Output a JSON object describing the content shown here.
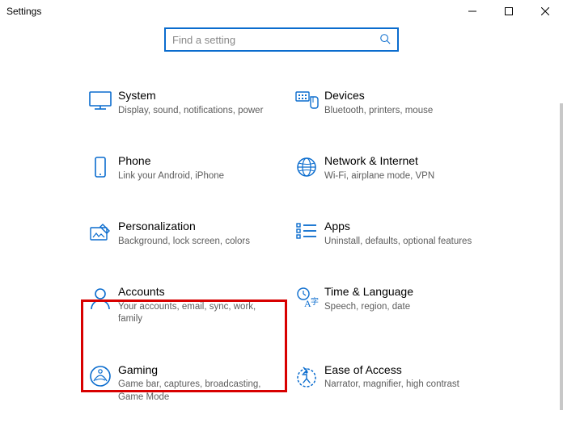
{
  "window": {
    "title": "Settings",
    "minimize": "–",
    "maximize": "☐",
    "close": "✕"
  },
  "search": {
    "placeholder": "Find a setting"
  },
  "tiles": {
    "system": {
      "title": "System",
      "sub": "Display, sound, notifications, power"
    },
    "devices": {
      "title": "Devices",
      "sub": "Bluetooth, printers, mouse"
    },
    "phone": {
      "title": "Phone",
      "sub": "Link your Android, iPhone"
    },
    "network": {
      "title": "Network & Internet",
      "sub": "Wi-Fi, airplane mode, VPN"
    },
    "personalization": {
      "title": "Personalization",
      "sub": "Background, lock screen, colors"
    },
    "apps": {
      "title": "Apps",
      "sub": "Uninstall, defaults, optional features"
    },
    "accounts": {
      "title": "Accounts",
      "sub": "Your accounts, email, sync, work, family"
    },
    "timelang": {
      "title": "Time & Language",
      "sub": "Speech, region, date"
    },
    "gaming": {
      "title": "Gaming",
      "sub": "Game bar, captures, broadcasting, Game Mode"
    },
    "ease": {
      "title": "Ease of Access",
      "sub": "Narrator, magnifier, high contrast"
    }
  },
  "colors": {
    "accent": "#0a6cce",
    "icon": "#0a6cce",
    "highlight": "#d80000"
  }
}
